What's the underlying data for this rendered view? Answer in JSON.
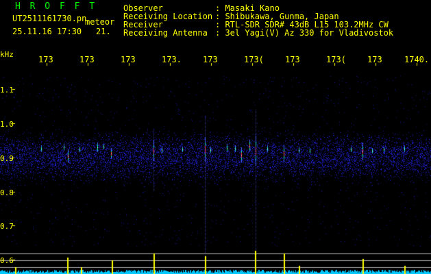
{
  "header": {
    "title": "H R O F F T",
    "file_name": "UT2511161730.pn",
    "mode": "meteor",
    "date_time": "25.11.16 17:30",
    "extra_value": "21.",
    "info_labels": [
      "Observer",
      "Receiving Location",
      "Receiver",
      "Receiving Antenna"
    ],
    "info_values": [
      ": Masaki Kano",
      ": Shibukawa, Gunma, Japan",
      ": RTL-SDR SDR# 43dB L15 103.2MHz CW",
      ": 3el Yagi(V) Az 330 for Vladivostok"
    ]
  },
  "axes": {
    "unit": "kHz",
    "y_ticks": [
      "1.1",
      "1.0",
      "0.9",
      "0.8",
      "0.7",
      "0.6"
    ],
    "x_ticks": [
      "173",
      "173",
      "173",
      "173.",
      "173",
      "173(",
      "173",
      "173(",
      "173",
      "1740."
    ]
  },
  "colors": {
    "background": "#000000",
    "text": "#ffff00",
    "title": "#00ff00",
    "noise": "#1a1aff",
    "echo_hot": "#ff3030",
    "echo_mid": "#00ffaa",
    "baseline": "#00c8ff",
    "peak": "#ffff00"
  }
}
